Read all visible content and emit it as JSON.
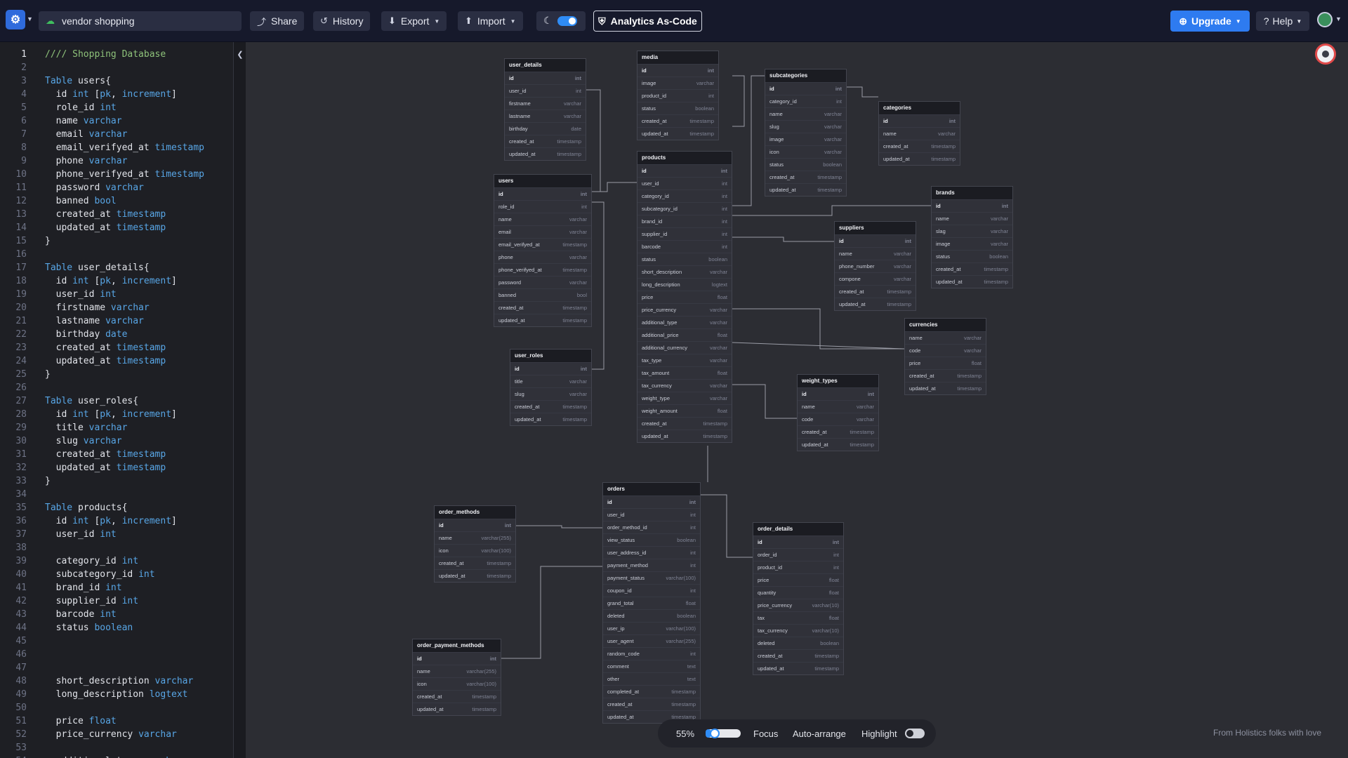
{
  "app": {
    "project_name": "vendor shopping",
    "buttons": {
      "share": "Share",
      "history": "History",
      "export": "Export",
      "import": "Import",
      "analytics": "Analytics As-Code",
      "upgrade": "Upgrade",
      "help": "Help"
    },
    "icons": {
      "logo": "dbdiagram-logo-icon",
      "cloud": "cloud-icon",
      "share": "share-icon",
      "history": "history-icon",
      "export": "download-icon",
      "import": "upload-icon",
      "theme": "moon-icon",
      "analytics": "shield-icon",
      "upgrade": "plus-circle-icon",
      "help": "question-icon"
    },
    "dark_mode_on": true
  },
  "editor": {
    "active_line": 1,
    "lines": [
      [
        {
          "t": "//// Shopping Database",
          "c": "cm"
        }
      ],
      [],
      [
        {
          "t": "Table",
          "c": "kw"
        },
        {
          "t": " users{"
        }
      ],
      [
        {
          "t": "  id "
        },
        {
          "t": "int",
          "c": "kw"
        },
        {
          "t": " ["
        },
        {
          "t": "pk",
          "c": "kw"
        },
        {
          "t": ", "
        },
        {
          "t": "increment",
          "c": "kw"
        },
        {
          "t": "]"
        }
      ],
      [
        {
          "t": "  role_id "
        },
        {
          "t": "int",
          "c": "kw"
        }
      ],
      [
        {
          "t": "  name "
        },
        {
          "t": "varchar",
          "c": "kw"
        }
      ],
      [
        {
          "t": "  email "
        },
        {
          "t": "varchar",
          "c": "kw"
        }
      ],
      [
        {
          "t": "  email_verifyed_at "
        },
        {
          "t": "timestamp",
          "c": "kw"
        }
      ],
      [
        {
          "t": "  phone "
        },
        {
          "t": "varchar",
          "c": "kw"
        }
      ],
      [
        {
          "t": "  phone_verifyed_at "
        },
        {
          "t": "timestamp",
          "c": "kw"
        }
      ],
      [
        {
          "t": "  password "
        },
        {
          "t": "varchar",
          "c": "kw"
        }
      ],
      [
        {
          "t": "  banned "
        },
        {
          "t": "bool",
          "c": "kw"
        }
      ],
      [
        {
          "t": "  created_at "
        },
        {
          "t": "timestamp",
          "c": "kw"
        }
      ],
      [
        {
          "t": "  updated_at "
        },
        {
          "t": "timestamp",
          "c": "kw"
        }
      ],
      [
        {
          "t": "}"
        }
      ],
      [],
      [
        {
          "t": "Table",
          "c": "kw"
        },
        {
          "t": " user_details{"
        }
      ],
      [
        {
          "t": "  id "
        },
        {
          "t": "int",
          "c": "kw"
        },
        {
          "t": " ["
        },
        {
          "t": "pk",
          "c": "kw"
        },
        {
          "t": ", "
        },
        {
          "t": "increment",
          "c": "kw"
        },
        {
          "t": "]"
        }
      ],
      [
        {
          "t": "  user_id "
        },
        {
          "t": "int",
          "c": "kw"
        }
      ],
      [
        {
          "t": "  firstname "
        },
        {
          "t": "varchar",
          "c": "kw"
        }
      ],
      [
        {
          "t": "  lastname "
        },
        {
          "t": "varchar",
          "c": "kw"
        }
      ],
      [
        {
          "t": "  birthday "
        },
        {
          "t": "date",
          "c": "kw"
        }
      ],
      [
        {
          "t": "  created_at "
        },
        {
          "t": "timestamp",
          "c": "kw"
        }
      ],
      [
        {
          "t": "  updated_at "
        },
        {
          "t": "timestamp",
          "c": "kw"
        }
      ],
      [
        {
          "t": "}"
        }
      ],
      [],
      [
        {
          "t": "Table",
          "c": "kw"
        },
        {
          "t": " user_roles{"
        }
      ],
      [
        {
          "t": "  id "
        },
        {
          "t": "int",
          "c": "kw"
        },
        {
          "t": " ["
        },
        {
          "t": "pk",
          "c": "kw"
        },
        {
          "t": ", "
        },
        {
          "t": "increment",
          "c": "kw"
        },
        {
          "t": "]"
        }
      ],
      [
        {
          "t": "  title "
        },
        {
          "t": "varchar",
          "c": "kw"
        }
      ],
      [
        {
          "t": "  slug "
        },
        {
          "t": "varchar",
          "c": "kw"
        }
      ],
      [
        {
          "t": "  created_at "
        },
        {
          "t": "timestamp",
          "c": "kw"
        }
      ],
      [
        {
          "t": "  updated_at "
        },
        {
          "t": "timestamp",
          "c": "kw"
        }
      ],
      [
        {
          "t": "}"
        }
      ],
      [],
      [
        {
          "t": "Table",
          "c": "kw"
        },
        {
          "t": " products{"
        }
      ],
      [
        {
          "t": "  id "
        },
        {
          "t": "int",
          "c": "kw"
        },
        {
          "t": " ["
        },
        {
          "t": "pk",
          "c": "kw"
        },
        {
          "t": ", "
        },
        {
          "t": "increment",
          "c": "kw"
        },
        {
          "t": "]"
        }
      ],
      [
        {
          "t": "  user_id "
        },
        {
          "t": "int",
          "c": "kw"
        }
      ],
      [],
      [
        {
          "t": "  category_id "
        },
        {
          "t": "int",
          "c": "kw"
        }
      ],
      [
        {
          "t": "  subcategory_id "
        },
        {
          "t": "int",
          "c": "kw"
        }
      ],
      [
        {
          "t": "  brand_id "
        },
        {
          "t": "int",
          "c": "kw"
        }
      ],
      [
        {
          "t": "  supplier_id "
        },
        {
          "t": "int",
          "c": "kw"
        }
      ],
      [
        {
          "t": "  barcode "
        },
        {
          "t": "int",
          "c": "kw"
        }
      ],
      [
        {
          "t": "  status "
        },
        {
          "t": "boolean",
          "c": "kw"
        }
      ],
      [],
      [],
      [],
      [
        {
          "t": "  short_description "
        },
        {
          "t": "varchar",
          "c": "kw"
        }
      ],
      [
        {
          "t": "  long_description "
        },
        {
          "t": "logtext",
          "c": "kw"
        }
      ],
      [],
      [
        {
          "t": "  price "
        },
        {
          "t": "float",
          "c": "kw"
        }
      ],
      [
        {
          "t": "  price_currency "
        },
        {
          "t": "varchar",
          "c": "kw"
        }
      ],
      [],
      [
        {
          "t": "  additional_type "
        },
        {
          "t": "varchar",
          "c": "kw"
        }
      ]
    ]
  },
  "tables": [
    {
      "name": "user_details",
      "rows": [
        [
          "id",
          "int"
        ],
        [
          "user_id",
          "int"
        ],
        [
          "firstname",
          "varchar"
        ],
        [
          "lastname",
          "varchar"
        ],
        [
          "birthday",
          "date"
        ],
        [
          "created_at",
          "timestamp"
        ],
        [
          "updated_at",
          "timestamp"
        ]
      ]
    },
    {
      "name": "media",
      "rows": [
        [
          "id",
          "int"
        ],
        [
          "image",
          "varchar"
        ],
        [
          "product_id",
          "int"
        ],
        [
          "status",
          "boolean"
        ],
        [
          "created_at",
          "timestamp"
        ],
        [
          "updated_at",
          "timestamp"
        ]
      ]
    },
    {
      "name": "subcategories",
      "rows": [
        [
          "id",
          "int"
        ],
        [
          "category_id",
          "int"
        ],
        [
          "name",
          "varchar"
        ],
        [
          "slug",
          "varchar"
        ],
        [
          "image",
          "varchar"
        ],
        [
          "icon",
          "varchar"
        ],
        [
          "status",
          "boolean"
        ],
        [
          "created_at",
          "timestamp"
        ],
        [
          "updated_at",
          "timestamp"
        ]
      ]
    },
    {
      "name": "categories",
      "rows": [
        [
          "id",
          "int"
        ],
        [
          "name",
          "varchar"
        ],
        [
          "created_at",
          "timestamp"
        ],
        [
          "updated_at",
          "timestamp"
        ]
      ]
    },
    {
      "name": "users",
      "rows": [
        [
          "id",
          "int"
        ],
        [
          "role_id",
          "int"
        ],
        [
          "name",
          "varchar"
        ],
        [
          "email",
          "varchar"
        ],
        [
          "email_verifyed_at",
          "timestamp"
        ],
        [
          "phone",
          "varchar"
        ],
        [
          "phone_verifyed_at",
          "timestamp"
        ],
        [
          "password",
          "varchar"
        ],
        [
          "banned",
          "bool"
        ],
        [
          "created_at",
          "timestamp"
        ],
        [
          "updated_at",
          "timestamp"
        ]
      ]
    },
    {
      "name": "products",
      "rows": [
        [
          "id",
          "int"
        ],
        [
          "user_id",
          "int"
        ],
        [
          "category_id",
          "int"
        ],
        [
          "subcategory_id",
          "int"
        ],
        [
          "brand_id",
          "int"
        ],
        [
          "supplier_id",
          "int"
        ],
        [
          "barcode",
          "int"
        ],
        [
          "status",
          "boolean"
        ],
        [
          "short_description",
          "varchar"
        ],
        [
          "long_description",
          "logtext"
        ],
        [
          "price",
          "float"
        ],
        [
          "price_currency",
          "varchar"
        ],
        [
          "additional_type",
          "varchar"
        ],
        [
          "additional_price",
          "float"
        ],
        [
          "additional_currency",
          "varchar"
        ],
        [
          "tax_type",
          "varchar"
        ],
        [
          "tax_amount",
          "float"
        ],
        [
          "tax_currency",
          "varchar"
        ],
        [
          "weight_type",
          "varchar"
        ],
        [
          "weight_amount",
          "float"
        ],
        [
          "created_at",
          "timestamp"
        ],
        [
          "updated_at",
          "timestamp"
        ]
      ]
    },
    {
      "name": "brands",
      "rows": [
        [
          "id",
          "int"
        ],
        [
          "name",
          "varchar"
        ],
        [
          "slag",
          "varchar"
        ],
        [
          "image",
          "varchar"
        ],
        [
          "status",
          "boolean"
        ],
        [
          "created_at",
          "timestamp"
        ],
        [
          "updated_at",
          "timestamp"
        ]
      ]
    },
    {
      "name": "suppliers",
      "rows": [
        [
          "id",
          "int"
        ],
        [
          "name",
          "varchar"
        ],
        [
          "phone_number",
          "varchar"
        ],
        [
          "compone",
          "varchar"
        ],
        [
          "created_at",
          "timestamp"
        ],
        [
          "updated_at",
          "timestamp"
        ]
      ]
    },
    {
      "name": "currencies",
      "rows": [
        [
          "name",
          "varchar"
        ],
        [
          "code",
          "varchar"
        ],
        [
          "price",
          "float"
        ],
        [
          "created_at",
          "timestamp"
        ],
        [
          "updated_at",
          "timestamp"
        ]
      ]
    },
    {
      "name": "user_roles",
      "rows": [
        [
          "id",
          "int"
        ],
        [
          "title",
          "varchar"
        ],
        [
          "slug",
          "varchar"
        ],
        [
          "created_at",
          "timestamp"
        ],
        [
          "updated_at",
          "timestamp"
        ]
      ]
    },
    {
      "name": "weight_types",
      "rows": [
        [
          "id",
          "int"
        ],
        [
          "name",
          "varchar"
        ],
        [
          "code",
          "varchar"
        ],
        [
          "created_at",
          "timestamp"
        ],
        [
          "updated_at",
          "timestamp"
        ]
      ]
    },
    {
      "name": "orders",
      "rows": [
        [
          "id",
          "int"
        ],
        [
          "user_id",
          "int"
        ],
        [
          "order_method_id",
          "int"
        ],
        [
          "view_status",
          "boolean"
        ],
        [
          "user_address_id",
          "int"
        ],
        [
          "payment_method",
          "int"
        ],
        [
          "payment_status",
          "varchar(100)"
        ],
        [
          "coupon_id",
          "int"
        ],
        [
          "grand_total",
          "float"
        ],
        [
          "deleted",
          "boolean"
        ],
        [
          "user_ip",
          "varchar(100)"
        ],
        [
          "user_agent",
          "varchar(255)"
        ],
        [
          "random_code",
          "int"
        ],
        [
          "comment",
          "text"
        ],
        [
          "other",
          "text"
        ],
        [
          "completed_at",
          "timestamp"
        ],
        [
          "created_at",
          "timestamp"
        ],
        [
          "updated_at",
          "timestamp"
        ]
      ]
    },
    {
      "name": "order_methods",
      "rows": [
        [
          "id",
          "int"
        ],
        [
          "name",
          "varchar(255)"
        ],
        [
          "icon",
          "varchar(100)"
        ],
        [
          "created_at",
          "timestamp"
        ],
        [
          "updated_at",
          "timestamp"
        ]
      ]
    },
    {
      "name": "order_details",
      "rows": [
        [
          "id",
          "int"
        ],
        [
          "order_id",
          "int"
        ],
        [
          "product_id",
          "int"
        ],
        [
          "price",
          "float"
        ],
        [
          "quantity",
          "float"
        ],
        [
          "price_currency",
          "varchar(10)"
        ],
        [
          "tax",
          "float"
        ],
        [
          "tax_currency",
          "varchar(10)"
        ],
        [
          "deleted",
          "boolean"
        ],
        [
          "created_at",
          "timestamp"
        ],
        [
          "updated_at",
          "timestamp"
        ]
      ]
    },
    {
      "name": "order_payment_methods",
      "rows": [
        [
          "id",
          "int"
        ],
        [
          "name",
          "varchar(255)"
        ],
        [
          "icon",
          "varchar(100)"
        ],
        [
          "created_at",
          "timestamp"
        ],
        [
          "updated_at",
          "timestamp"
        ]
      ]
    }
  ],
  "controls": {
    "zoom_label": "55%",
    "zoom_level": 0.55,
    "focus": "Focus",
    "auto_arrange": "Auto-arrange",
    "highlight": "Highlight",
    "highlight_on": false
  },
  "credit": "From Holistics folks with love",
  "colors": {
    "accent": "#2e7bf0",
    "keyword": "#58a6e6",
    "comment": "#8ec27a",
    "alert": "#e04a4a"
  }
}
